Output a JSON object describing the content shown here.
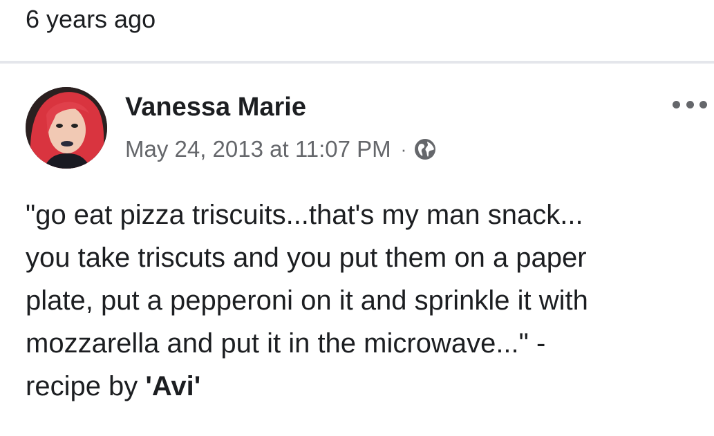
{
  "previous_post": {
    "timestamp": "6 years ago"
  },
  "post": {
    "author": "Vanessa Marie",
    "date": "May 24, 2013 at 11:07 PM",
    "separator": "·",
    "privacy_icon": "globe-icon",
    "more_icon": "more-options-icon",
    "body_text": "\"go eat pizza triscuits...that's my man snack...\nyou take triscuts and you put them on a paper\nplate, put a pepperoni on it and sprinkle it with\nmozzarella and put it in the microwave...\" -\nrecipe by ",
    "body_emphasis": "'Avi'"
  },
  "colors": {
    "text_primary": "#1c1e21",
    "text_secondary": "#65676b",
    "divider": "#e4e6eb",
    "background": "#ffffff"
  }
}
